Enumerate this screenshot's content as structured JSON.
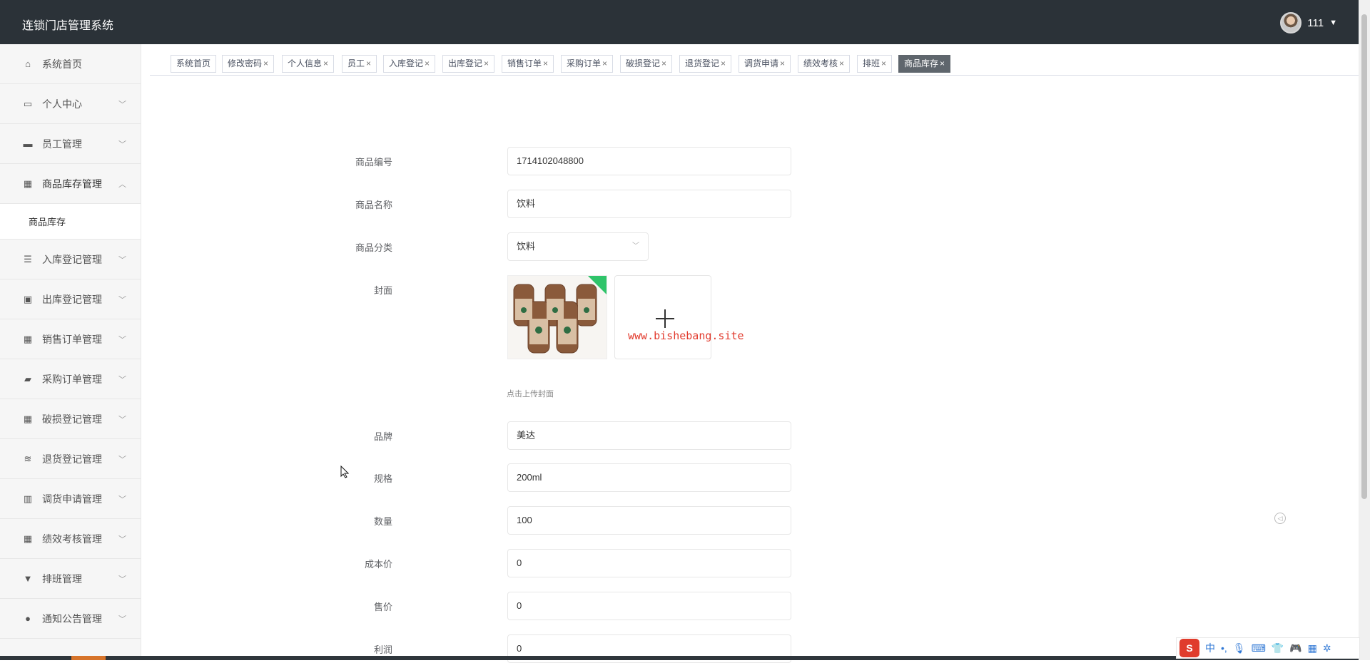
{
  "app": {
    "title": "连锁门店管理系统",
    "user_name": "111",
    "accent_color": "#2b3238"
  },
  "sidebar": {
    "items": [
      {
        "label": "系统首页",
        "icon": "home-icon"
      },
      {
        "label": "个人中心",
        "icon": "wallet-icon"
      },
      {
        "label": "员工管理",
        "icon": "ticket-icon"
      },
      {
        "label": "商品库存管理",
        "icon": "grid-icon"
      },
      {
        "label": "入库登记管理",
        "icon": "list-icon"
      },
      {
        "label": "出库登记管理",
        "icon": "clipboard-icon"
      },
      {
        "label": "销售订单管理",
        "icon": "grid-icon"
      },
      {
        "label": "采购订单管理",
        "icon": "printer-icon"
      },
      {
        "label": "破损登记管理",
        "icon": "grid-icon"
      },
      {
        "label": "退货登记管理",
        "icon": "sliders-icon"
      },
      {
        "label": "调货申请管理",
        "icon": "chart-icon"
      },
      {
        "label": "绩效考核管理",
        "icon": "grid-icon"
      },
      {
        "label": "排班管理",
        "icon": "brush-icon"
      },
      {
        "label": "通知公告管理",
        "icon": "user-icon"
      }
    ],
    "active_sub_item": "商品库存"
  },
  "tabs": [
    {
      "label": "系统首页",
      "closable": false
    },
    {
      "label": "修改密码",
      "closable": true
    },
    {
      "label": "个人信息",
      "closable": true
    },
    {
      "label": "员工",
      "closable": true
    },
    {
      "label": "入库登记",
      "closable": true
    },
    {
      "label": "出库登记",
      "closable": true
    },
    {
      "label": "销售订单",
      "closable": true
    },
    {
      "label": "采购订单",
      "closable": true
    },
    {
      "label": "破损登记",
      "closable": true
    },
    {
      "label": "退货登记",
      "closable": true
    },
    {
      "label": "调货申请",
      "closable": true
    },
    {
      "label": "绩效考核",
      "closable": true
    },
    {
      "label": "排班",
      "closable": true
    },
    {
      "label": "商品库存",
      "closable": true,
      "active": true
    }
  ],
  "form": {
    "product_code": {
      "label": "商品编号",
      "value": "1714102048800"
    },
    "product_name": {
      "label": "商品名称",
      "value": "饮料"
    },
    "category": {
      "label": "商品分类",
      "value": "饮料"
    },
    "cover": {
      "label": "封面",
      "hint": "点击上传封面"
    },
    "brand": {
      "label": "品牌",
      "value": "美达"
    },
    "spec": {
      "label": "规格",
      "value": "200ml"
    },
    "quantity": {
      "label": "数量",
      "value": "100"
    },
    "cost_price": {
      "label": "成本价",
      "value": "0"
    },
    "sale_price": {
      "label": "售价",
      "value": "0"
    },
    "profit": {
      "label": "利润",
      "value": "0"
    }
  },
  "watermark": "www.bishebang.site",
  "ime": {
    "logo": "S",
    "mode": "中"
  }
}
